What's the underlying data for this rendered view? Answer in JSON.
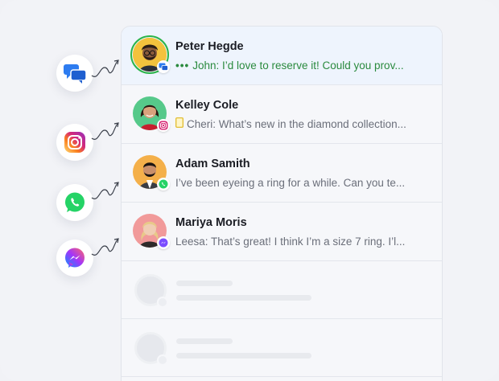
{
  "channels": [
    {
      "name": "messenger-chat-icon",
      "color": "#2d7cf0"
    },
    {
      "name": "instagram-icon",
      "color": "#e1306c"
    },
    {
      "name": "whatsapp-icon",
      "color": "#25d366"
    },
    {
      "name": "facebook-messenger-icon",
      "color": "#7b4dff"
    }
  ],
  "conversations": [
    {
      "name": "Peter Hegde",
      "preview": "John: I’d love to reserve it! Could you prov...",
      "typing_indicator": "•••",
      "channel_badge": "chat-badge-icon",
      "active": true
    },
    {
      "name": "Kelley Cole",
      "preview": "Cheri: What’s new in the diamond collection...",
      "channel_badge": "instagram-badge-icon",
      "active": false
    },
    {
      "name": "Adam Samith",
      "preview": "I’ve been eyeing a ring for a while. Can you te...",
      "channel_badge": "whatsapp-badge-icon",
      "active": false
    },
    {
      "name": "Mariya  Moris",
      "preview": "Leesa: That’s great! I think I’m a size 7 ring. I’l...",
      "channel_badge": "messenger-badge-icon",
      "active": false
    }
  ],
  "colors": {
    "active_row": "#eef4fd",
    "typing_text": "#2a8a3e",
    "online_ring": "#2cb44b"
  }
}
